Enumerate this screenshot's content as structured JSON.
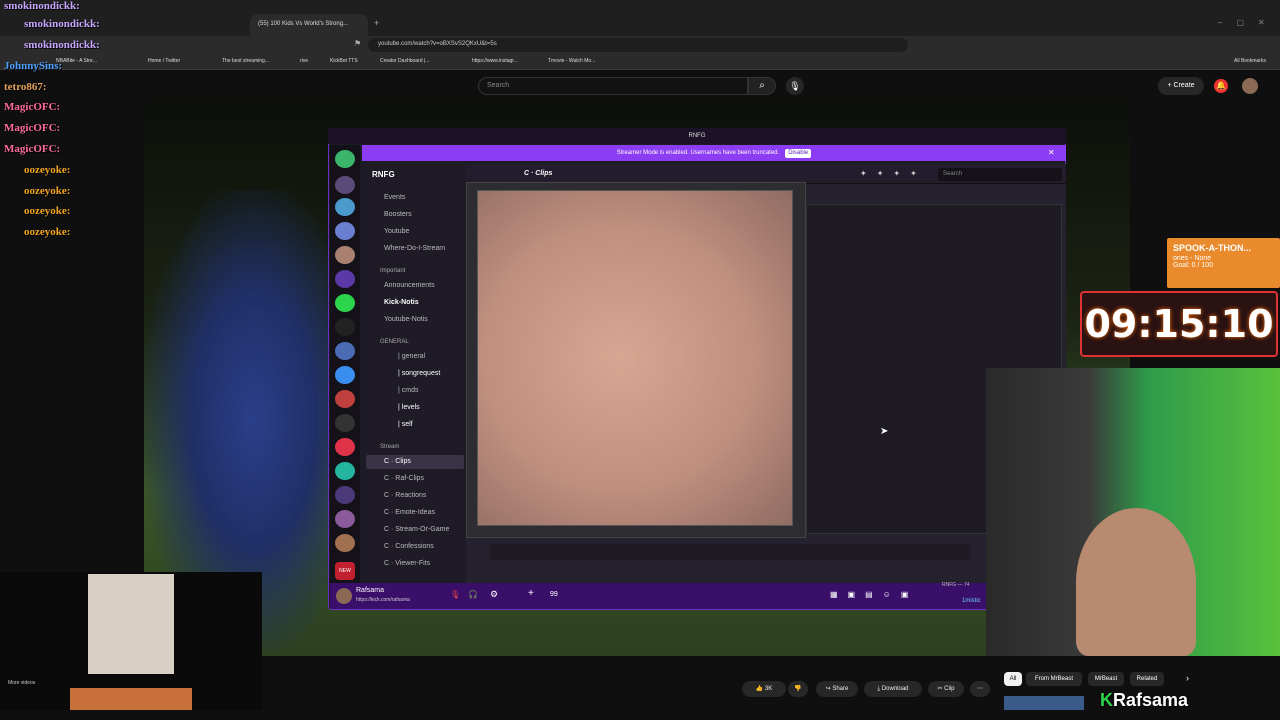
{
  "browser": {
    "active_tab_title": "(55) 100 Kids Vs World's Strong...",
    "url": "youtube.com/watch?v=oBXSvS2QKxU&t=5s",
    "bookmarks": [
      "NBABite - A Stre...",
      "Home / Twitter",
      "The best streaming...",
      "rive",
      "KickBot TTS",
      "Creator Dashboard |...",
      "https://www.instagr...",
      "Tmovie - Watch Mo...",
      "All Bookmarks"
    ]
  },
  "youtube": {
    "search_placeholder": "Search",
    "create_label": "Create",
    "actions": {
      "like_count": "3K",
      "share": "Share",
      "download": "Download",
      "clip": "Clip"
    },
    "chips": [
      "All",
      "From MrBeast",
      "MrBeast",
      "Related"
    ],
    "pip_caption": "More videos"
  },
  "chat": [
    {
      "user": "smokinondickk:",
      "color": "#c9a6ff"
    },
    {
      "user": "smokinondickk:",
      "color": "#c9a6ff"
    },
    {
      "user": "smokinondickk:",
      "color": "#c9a6ff"
    },
    {
      "user": "JohnnySins:",
      "color": "#4fa0ff"
    },
    {
      "user": "tetro867:",
      "color": "#e6a15a"
    },
    {
      "user": "MagicOFC:",
      "color": "#ff6aa0"
    },
    {
      "user": "MagicOFC:",
      "color": "#ff6aa0"
    },
    {
      "user": "MagicOFC:",
      "color": "#ff6aa0"
    },
    {
      "user": "oozeyoke:",
      "color": "#f5a623"
    },
    {
      "user": "oozeyoke:",
      "color": "#f5a623"
    },
    {
      "user": "oozeyoke:",
      "color": "#f5a623"
    },
    {
      "user": "oozeyoke:",
      "color": "#f5a623"
    }
  ],
  "discord": {
    "window_title": "RNFG",
    "banner_text": "Streamer Mode is enabled. Usernames have been truncated.",
    "banner_button": "Disable",
    "server_name": "RNFG",
    "current_channel": "C · Clips",
    "search_placeholder": "Search",
    "channels": [
      {
        "name": "Events"
      },
      {
        "name": "Boosters"
      },
      {
        "name": "Youtube"
      },
      {
        "name": "Where-Do-I-Stream"
      },
      {
        "name": "Important"
      },
      {
        "name": "Announcements"
      },
      {
        "name": "Kick-Notis"
      },
      {
        "name": "Youtube-Notis"
      },
      {
        "name": "GENERAL"
      },
      {
        "name": "| general"
      },
      {
        "name": "| songrequest"
      },
      {
        "name": "| cmds"
      },
      {
        "name": "| levels"
      },
      {
        "name": "| self"
      },
      {
        "name": "Stream"
      },
      {
        "name": "C · Clips"
      },
      {
        "name": "C · Raf-Clips"
      },
      {
        "name": "C · Reactions"
      },
      {
        "name": "C · Emote-Ideas"
      },
      {
        "name": "C · Stream-Or-Game"
      },
      {
        "name": "C · Confessions"
      },
      {
        "name": "C · Viewer-Fits"
      }
    ],
    "user_name": "Rafsama",
    "user_status": "https://kick.com/rafsama",
    "message_count": "99",
    "member_label": "RNFG — 74",
    "member_name": "1mistic"
  },
  "widgets": {
    "goal_title": "SPOOK-A-THON...",
    "goal_sub": "ones - None",
    "goal_progress": "Goal: 0 / 100",
    "timer": "09:15:10",
    "watermark": "Rafsama"
  }
}
